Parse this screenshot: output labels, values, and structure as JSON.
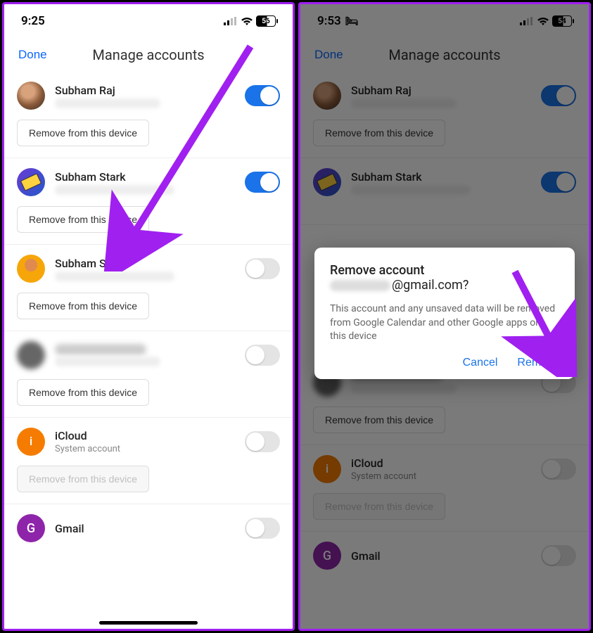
{
  "left": {
    "status": {
      "time": "9:25",
      "battery": "56"
    },
    "header": {
      "done": "Done",
      "title": "Manage accounts"
    },
    "accounts": [
      {
        "name": "Subham Raj",
        "remove": "Remove from this device",
        "toggle": "on"
      },
      {
        "name": "Subham Stark",
        "remove": "Remove from this device",
        "toggle": "on"
      },
      {
        "name": "Subham Stark",
        "remove": "Remove from this device",
        "toggle": "off"
      },
      {
        "name": "",
        "remove": "Remove from this device",
        "toggle": "off"
      },
      {
        "name": "iCloud",
        "sub": "System account",
        "remove": "Remove from this device",
        "toggle": "off",
        "disabled": true
      },
      {
        "name": "Gmail"
      }
    ]
  },
  "right": {
    "status": {
      "time": "9:53",
      "battery": "54"
    },
    "header": {
      "done": "Done",
      "title": "Manage accounts"
    },
    "dialog": {
      "title": "Remove account",
      "email_suffix": "@gmail.com?",
      "body": "This account and any unsaved data will be removed from Google Calendar and other Google apps on this device",
      "cancel": "Cancel",
      "remove": "Remove"
    },
    "accounts": [
      {
        "name": "Subham Raj",
        "remove": "Remove from this device",
        "toggle": "on"
      },
      {
        "name": "Subham Stark",
        "toggle": "on"
      },
      {
        "name": "",
        "remove": "Remove from this device",
        "toggle": "off"
      },
      {
        "name": "iCloud",
        "sub": "System account",
        "remove": "Remove from this device",
        "toggle": "off",
        "disabled": true
      },
      {
        "name": "Gmail"
      }
    ]
  },
  "colors": {
    "accent": "#1a73e8",
    "arrow": "#a020f0"
  }
}
